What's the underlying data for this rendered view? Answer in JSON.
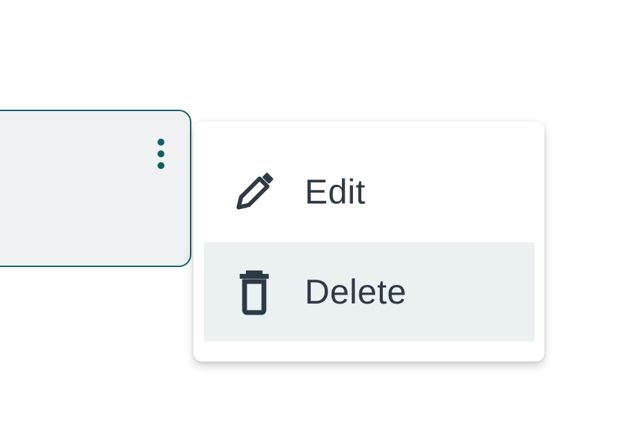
{
  "menu": {
    "items": [
      {
        "label": "Edit",
        "icon": "pencil-icon"
      },
      {
        "label": "Delete",
        "icon": "trash-icon"
      }
    ]
  },
  "card": {
    "more_icon": "more-vertical-icon"
  },
  "colors": {
    "accent": "#0f5f66",
    "card_bg": "#eff1f3",
    "text": "#2f3a47",
    "hover_bg": "#ebf1f1"
  }
}
